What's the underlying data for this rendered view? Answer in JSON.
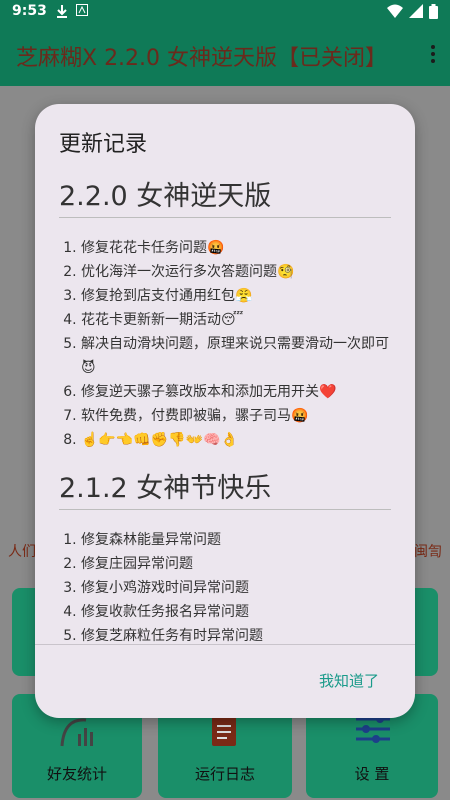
{
  "status_bar": {
    "time": "9:53"
  },
  "app_bar": {
    "title": "芝麻糊X 2.2.0 女神逆天版【已关闭】"
  },
  "background": {
    "notice_left": "人们",
    "notice_right": "闽訇",
    "cards": [
      {
        "label": "好友统计"
      },
      {
        "label": "运行日志"
      },
      {
        "label": "设 置"
      }
    ]
  },
  "dialog": {
    "title": "更新记录",
    "versions": [
      {
        "title": "2.2.0 女神逆天版",
        "items": [
          "修复花花卡任务问题🤬",
          "优化海洋一次运行多次答题问题🧐",
          "修复抢到店支付通用红包😤",
          "花花卡更新新一期活动😴",
          "解决自动滑块问题，原理来说只需要滑动一次即可😈",
          "修复逆天骡子篡改版本和添加无用开关❤️",
          "软件免费，付费即被骗，骡子司马🤬",
          "☝️👉👈👊✊👎👐🧠👌"
        ]
      },
      {
        "title": "2.1.2 女神节快乐",
        "items": [
          "修复森林能量异常问题",
          "修复庄园异常问题",
          "修复小鸡游戏时间异常问题",
          "修复收款任务报名异常问题",
          "修复芝麻粒任务有时异常问题"
        ]
      }
    ],
    "ok_label": "我知道了"
  }
}
